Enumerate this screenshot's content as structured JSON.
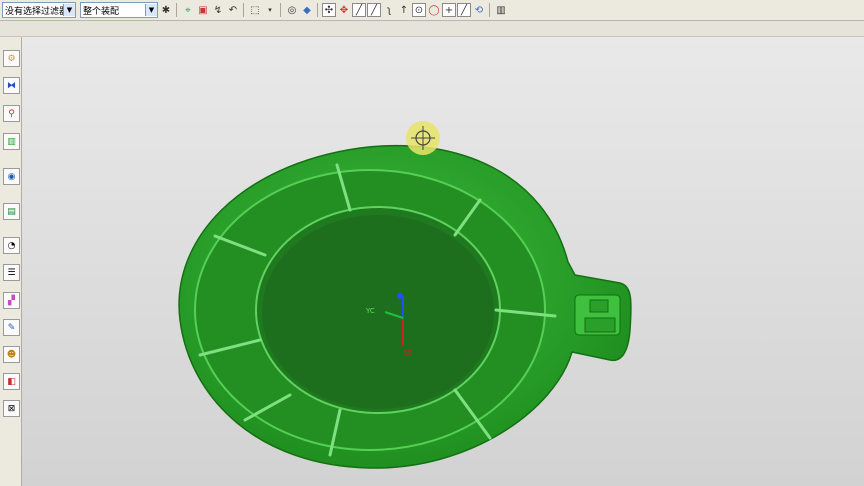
{
  "toolbar": {
    "filter_select": {
      "value": "没有选择过滤器"
    },
    "assembly_select": {
      "value": "整个装配"
    },
    "icons": [
      "select-filter-icon",
      "snap-icon",
      "selection-icon",
      "lasso-icon",
      "undo-icon",
      "point-icon",
      "box-select-icon",
      "view-icon",
      "shade-icon",
      "fit-icon",
      "line-icon",
      "arc-icon",
      "curve-icon",
      "tangent-icon",
      "circle-icon",
      "center-icon",
      "cross-icon",
      "slash-icon",
      "rotate-icon",
      "layer-icon"
    ]
  },
  "left_toolbar": {
    "icons": [
      "part-navigator-icon",
      "assembly-navigator-icon",
      "constraint-icon",
      "reuse-library-icon",
      "web-browser-icon",
      "history-icon",
      "clock-icon",
      "list-icon",
      "palette-icon",
      "roles-icon",
      "system-scene-icon",
      "materials-icon",
      "sketch-icon"
    ]
  },
  "viewport": {
    "axis_labels": {
      "yc": "YC",
      "xc": "XC",
      "zc": "ZC"
    },
    "model_color": "#2aa52a",
    "background": "#dcdcdc"
  }
}
